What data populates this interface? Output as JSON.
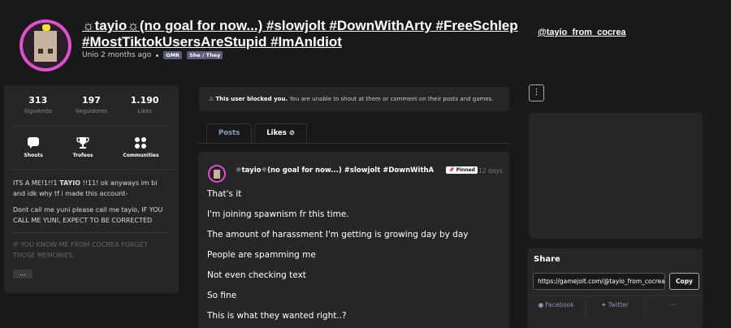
{
  "profile": {
    "title": "☼tayio☼(no goal for now...) #slowjolt #DownWithArty #FreeSchlep #MostTiktokUsersAreStupid #ImAnIdiot",
    "meta_joined": "Unio 2 months ago",
    "tags": [
      "GMR",
      "She / They"
    ],
    "username": "@tayio_from_cocrea",
    "avatar_colors": {
      "ring": "#e04fd0",
      "hat": "#f2e233"
    }
  },
  "stats": [
    {
      "value": "313",
      "label": "Siguiendo"
    },
    {
      "value": "197",
      "label": "Seguidores"
    },
    {
      "value": "1.190",
      "label": "Likes"
    }
  ],
  "actions": [
    {
      "icon": "speech-bubble-icon",
      "label": "Shouts"
    },
    {
      "icon": "trophy-icon",
      "label": "Trofeos"
    },
    {
      "icon": "communities-icon",
      "label": "Communities"
    }
  ],
  "bio": {
    "line1_pre": "ITS A ME!1!!1 ",
    "line1_bold": "TAYIO",
    "line1_post": " !!11! ok anyways im bi and idk why tf i made this account-",
    "line2": "Dont call me yuni please call me tayio, IF YOU CALL ME YUNI, EXPECT TO BE CORRECTED",
    "line3": "IF YOU KNOW ME FROM COCREA FORGET THOSE MEMORIES.",
    "more": "..."
  },
  "blocked": {
    "bold": "This user blocked you.",
    "text": " You are unable to shout at them or comment on their posts and games."
  },
  "tabs": [
    {
      "label": "Posts",
      "active": true
    },
    {
      "label": "Likes",
      "active": false
    }
  ],
  "post": {
    "author": "☼tayio☼(no goal for now...) #slowjolt #DownWithArty #...",
    "pinned": "Pinned",
    "time": "12 days",
    "lines": [
      "That's it",
      "I'm joining spawnism fr this time.",
      "The amount of harassment I'm getting is growing day by day",
      "People are spamming me",
      "Not even checking text",
      "So fine",
      "This is what they wanted right..?"
    ]
  },
  "menu_button": "⋮",
  "share": {
    "title": "Share",
    "url": "https://gamejolt.com/@tayio_from_cocrea",
    "copy": "Copy",
    "links": [
      "Facebook",
      "Twitter",
      "···"
    ]
  }
}
